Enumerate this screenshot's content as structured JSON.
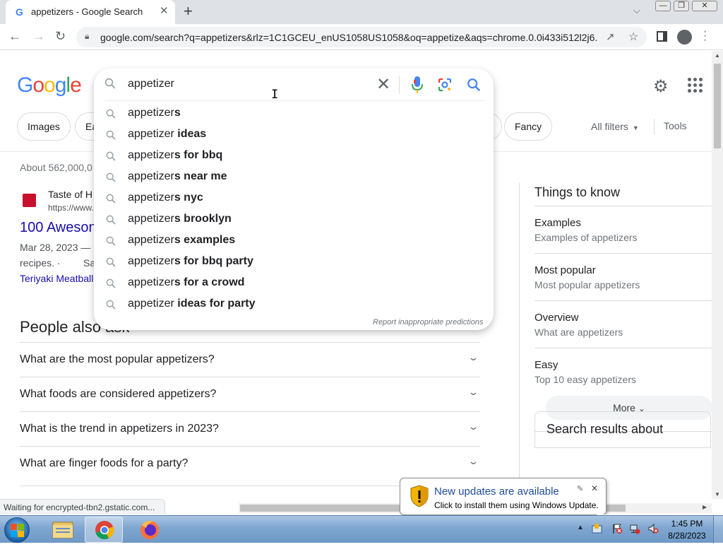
{
  "browser": {
    "tab_title": "appetizers - Google Search",
    "tab_favicon": "G",
    "new_tab_label": "+",
    "tab_close": "✕",
    "url": "google.com/search?q=appetizers&rlz=1C1GCEU_enUS1058US1058&oq=appetize&aqs=chrome.0.0i433i512l2j6...",
    "window_buttons": [
      "—",
      "❐",
      "✕"
    ]
  },
  "google": {
    "logo_letters": [
      "G",
      "o",
      "o",
      "g",
      "l",
      "e"
    ],
    "chips": [
      "Images",
      "Ea",
      "Fancy"
    ],
    "all_filters": "All filters",
    "tools": "Tools",
    "result_stats": "About 562,000,0"
  },
  "search": {
    "query": "appetizer",
    "suggestions": [
      {
        "typed": "appetizer",
        "completion": "s"
      },
      {
        "typed": "appetizer",
        "completion": " ideas"
      },
      {
        "typed": "appetizer",
        "completion": "s for bbq"
      },
      {
        "typed": "appetizer",
        "completion": "s near me"
      },
      {
        "typed": "appetizer",
        "completion": "s nyc"
      },
      {
        "typed": "appetizer",
        "completion": "s brooklyn"
      },
      {
        "typed": "appetizer",
        "completion": "s examples"
      },
      {
        "typed": "appetizer",
        "completion": "s for bbq party"
      },
      {
        "typed": "appetizer",
        "completion": "s for a crowd"
      },
      {
        "typed": "appetizer",
        "completion": " ideas for party"
      }
    ],
    "report_link": "Report inappropriate predictions"
  },
  "result": {
    "site_name": "Taste of H",
    "site_url": "https://www.",
    "title": "100 Aweson",
    "snippet_1": "Mar 28, 2023 —",
    "snippet_1_tail": "Savory",
    "snippet_2": "recipes. ·",
    "sitelink": "Teriyaki Meatball"
  },
  "people_also_ask": {
    "heading": "People also ask",
    "questions": [
      "What are the most popular appetizers?",
      "What foods are considered appetizers?",
      "What is the trend in appetizers in 2023?",
      "What are finger foods for a party?"
    ]
  },
  "things_to_know": {
    "heading": "Things to know",
    "items": [
      {
        "title": "Examples",
        "subtitle": "Examples of appetizers"
      },
      {
        "title": "Most popular",
        "subtitle": "Most popular appetizers"
      },
      {
        "title": "Overview",
        "subtitle": "What are appetizers"
      },
      {
        "title": "Easy",
        "subtitle": "Top 10 easy appetizers"
      }
    ],
    "more_label": "More",
    "search_results_about": "Search results about"
  },
  "status_bar": "Waiting for encrypted-tbn2.gstatic.com...",
  "windows_update": {
    "title": "New updates are available",
    "body": "Click to install them using Windows Update."
  },
  "taskbar": {
    "time": "1:45 PM",
    "date": "8/28/2023"
  },
  "colors": {
    "google_blue": "#4285f4",
    "link_blue": "#1a0dab",
    "mic_red": "#ea4335"
  }
}
